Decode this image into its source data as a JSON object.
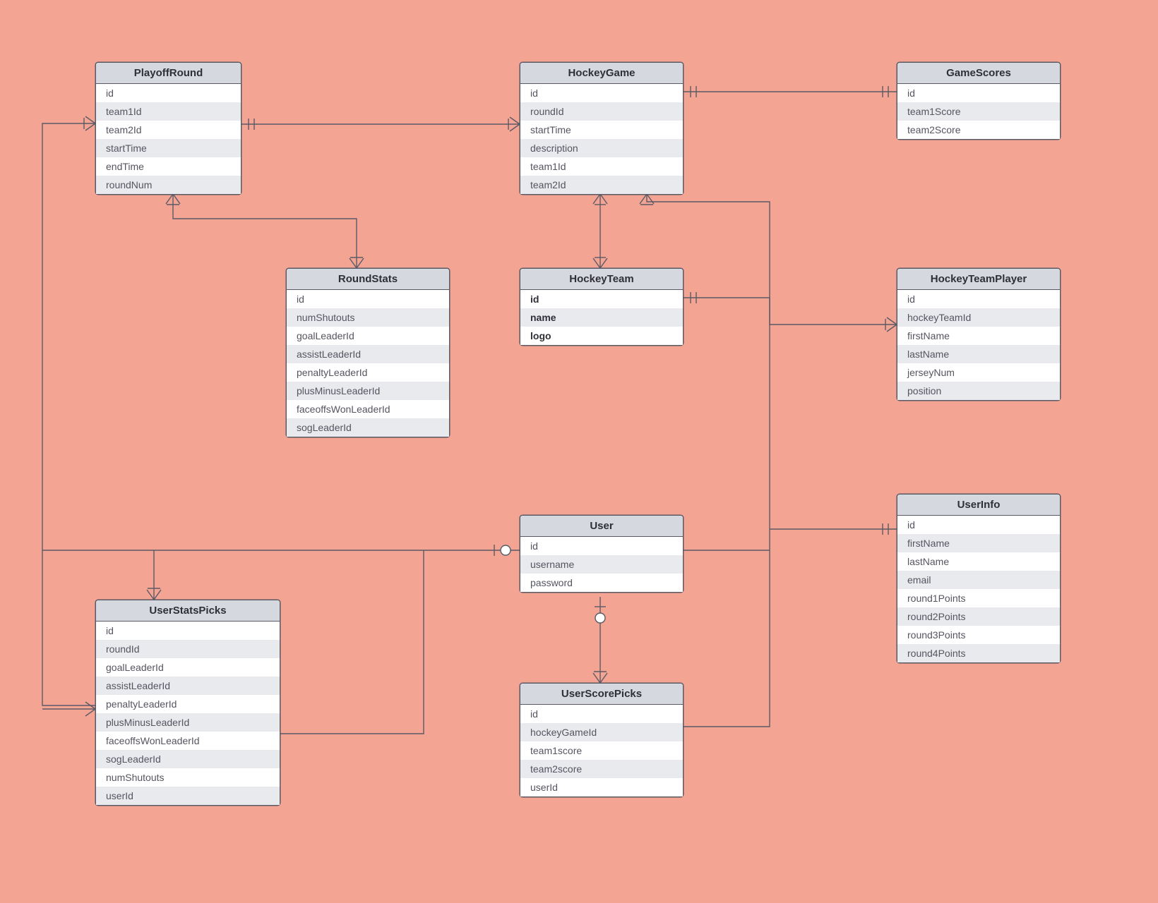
{
  "entities": {
    "playoffRound": {
      "title": "PlayoffRound",
      "fields": [
        "id",
        "team1Id",
        "team2Id",
        "startTime",
        "endTime",
        "roundNum"
      ]
    },
    "hockeyGame": {
      "title": "HockeyGame",
      "fields": [
        "id",
        "roundId",
        "startTime",
        "description",
        "team1Id",
        "team2Id"
      ]
    },
    "gameScores": {
      "title": "GameScores",
      "fields": [
        "id",
        "team1Score",
        "team2Score"
      ]
    },
    "roundStats": {
      "title": "RoundStats",
      "fields": [
        "id",
        "numShutouts",
        "goalLeaderId",
        "assistLeaderId",
        "penaltyLeaderId",
        "plusMinusLeaderId",
        "faceoffsWonLeaderId",
        "sogLeaderId"
      ]
    },
    "hockeyTeam": {
      "title": "HockeyTeam",
      "boldFields": [
        "id",
        "name",
        "logo"
      ]
    },
    "hockeyTeamPlayer": {
      "title": "HockeyTeamPlayer",
      "fields": [
        "id",
        "hockeyTeamId",
        "firstName",
        "lastName",
        "jerseyNum",
        "position"
      ]
    },
    "user": {
      "title": "User",
      "fields": [
        "id",
        "username",
        "password"
      ]
    },
    "userInfo": {
      "title": "UserInfo",
      "fields": [
        "id",
        "firstName",
        "lastName",
        "email",
        "round1Points",
        "round2Points",
        "round3Points",
        "round4Points"
      ]
    },
    "userStatsPicks": {
      "title": "UserStatsPicks",
      "fields": [
        "id",
        "roundId",
        "goalLeaderId",
        "assistLeaderId",
        "penaltyLeaderId",
        "plusMinusLeaderId",
        "faceoffsWonLeaderId",
        "sogLeaderId",
        "numShutouts",
        "userId"
      ]
    },
    "userScorePicks": {
      "title": "UserScorePicks",
      "fields": [
        "id",
        "hockeyGameId",
        "team1score",
        "team2score",
        "userId"
      ]
    }
  }
}
